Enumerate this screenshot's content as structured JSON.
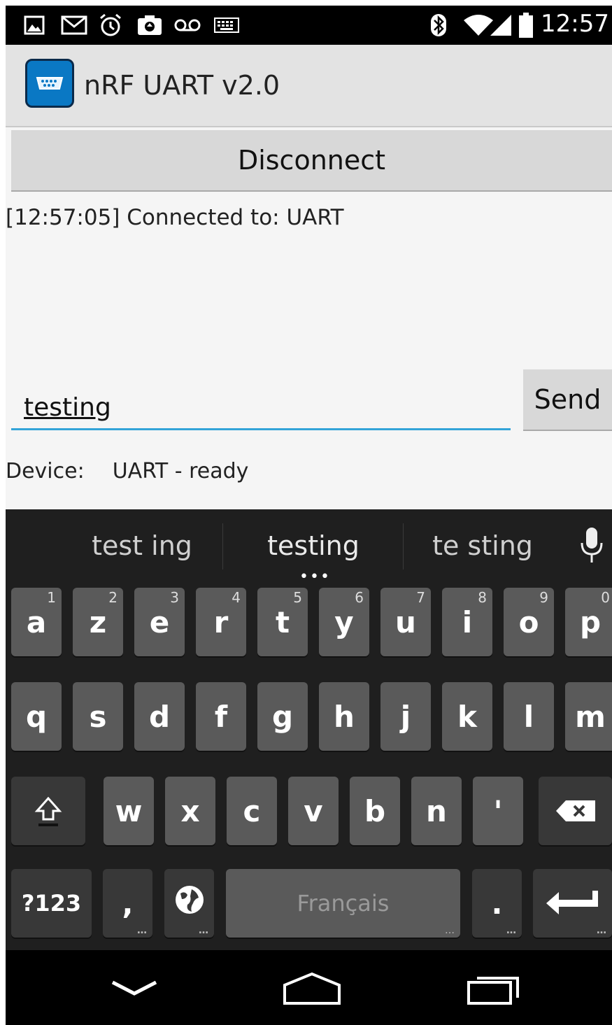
{
  "status_bar": {
    "time": "12:57",
    "left_icons": [
      "image-icon",
      "gmail-icon",
      "alarm-icon",
      "camera-icon",
      "voicemail-icon",
      "keyboard-icon"
    ],
    "right_icons": [
      "bluetooth-icon",
      "wifi-icon",
      "signal-icon",
      "battery-icon"
    ]
  },
  "app": {
    "title": "nRF UART v2.0",
    "logo_icon": "serial-port-icon"
  },
  "main": {
    "disconnect_label": "Disconnect",
    "log": [
      "[12:57:05] Connected to: UART"
    ],
    "input_value": "testing",
    "send_label": "Send",
    "device_label": "Device:",
    "device_status": "UART - ready"
  },
  "keyboard": {
    "suggestions": [
      "test ing",
      "testing",
      "te sting"
    ],
    "row1": [
      {
        "k": "a",
        "n": "1"
      },
      {
        "k": "z",
        "n": "2"
      },
      {
        "k": "e",
        "n": "3"
      },
      {
        "k": "r",
        "n": "4"
      },
      {
        "k": "t",
        "n": "5"
      },
      {
        "k": "y",
        "n": "6"
      },
      {
        "k": "u",
        "n": "7"
      },
      {
        "k": "i",
        "n": "8"
      },
      {
        "k": "o",
        "n": "9"
      },
      {
        "k": "p",
        "n": "0"
      }
    ],
    "row2": [
      "q",
      "s",
      "d",
      "f",
      "g",
      "h",
      "j",
      "k",
      "l",
      "m"
    ],
    "row3": [
      "w",
      "x",
      "c",
      "v",
      "b",
      "n",
      "'"
    ],
    "symbols_label": "?123",
    "comma_label": ",",
    "space_label": "Français",
    "period_label": ".",
    "colors": {
      "key": "#5a5a5a",
      "key_dark": "#383838",
      "background": "#1f1f1f",
      "accent": "#33a4d8"
    }
  },
  "nav_bar": {
    "icons": [
      "back-icon",
      "home-icon",
      "recents-icon"
    ]
  }
}
